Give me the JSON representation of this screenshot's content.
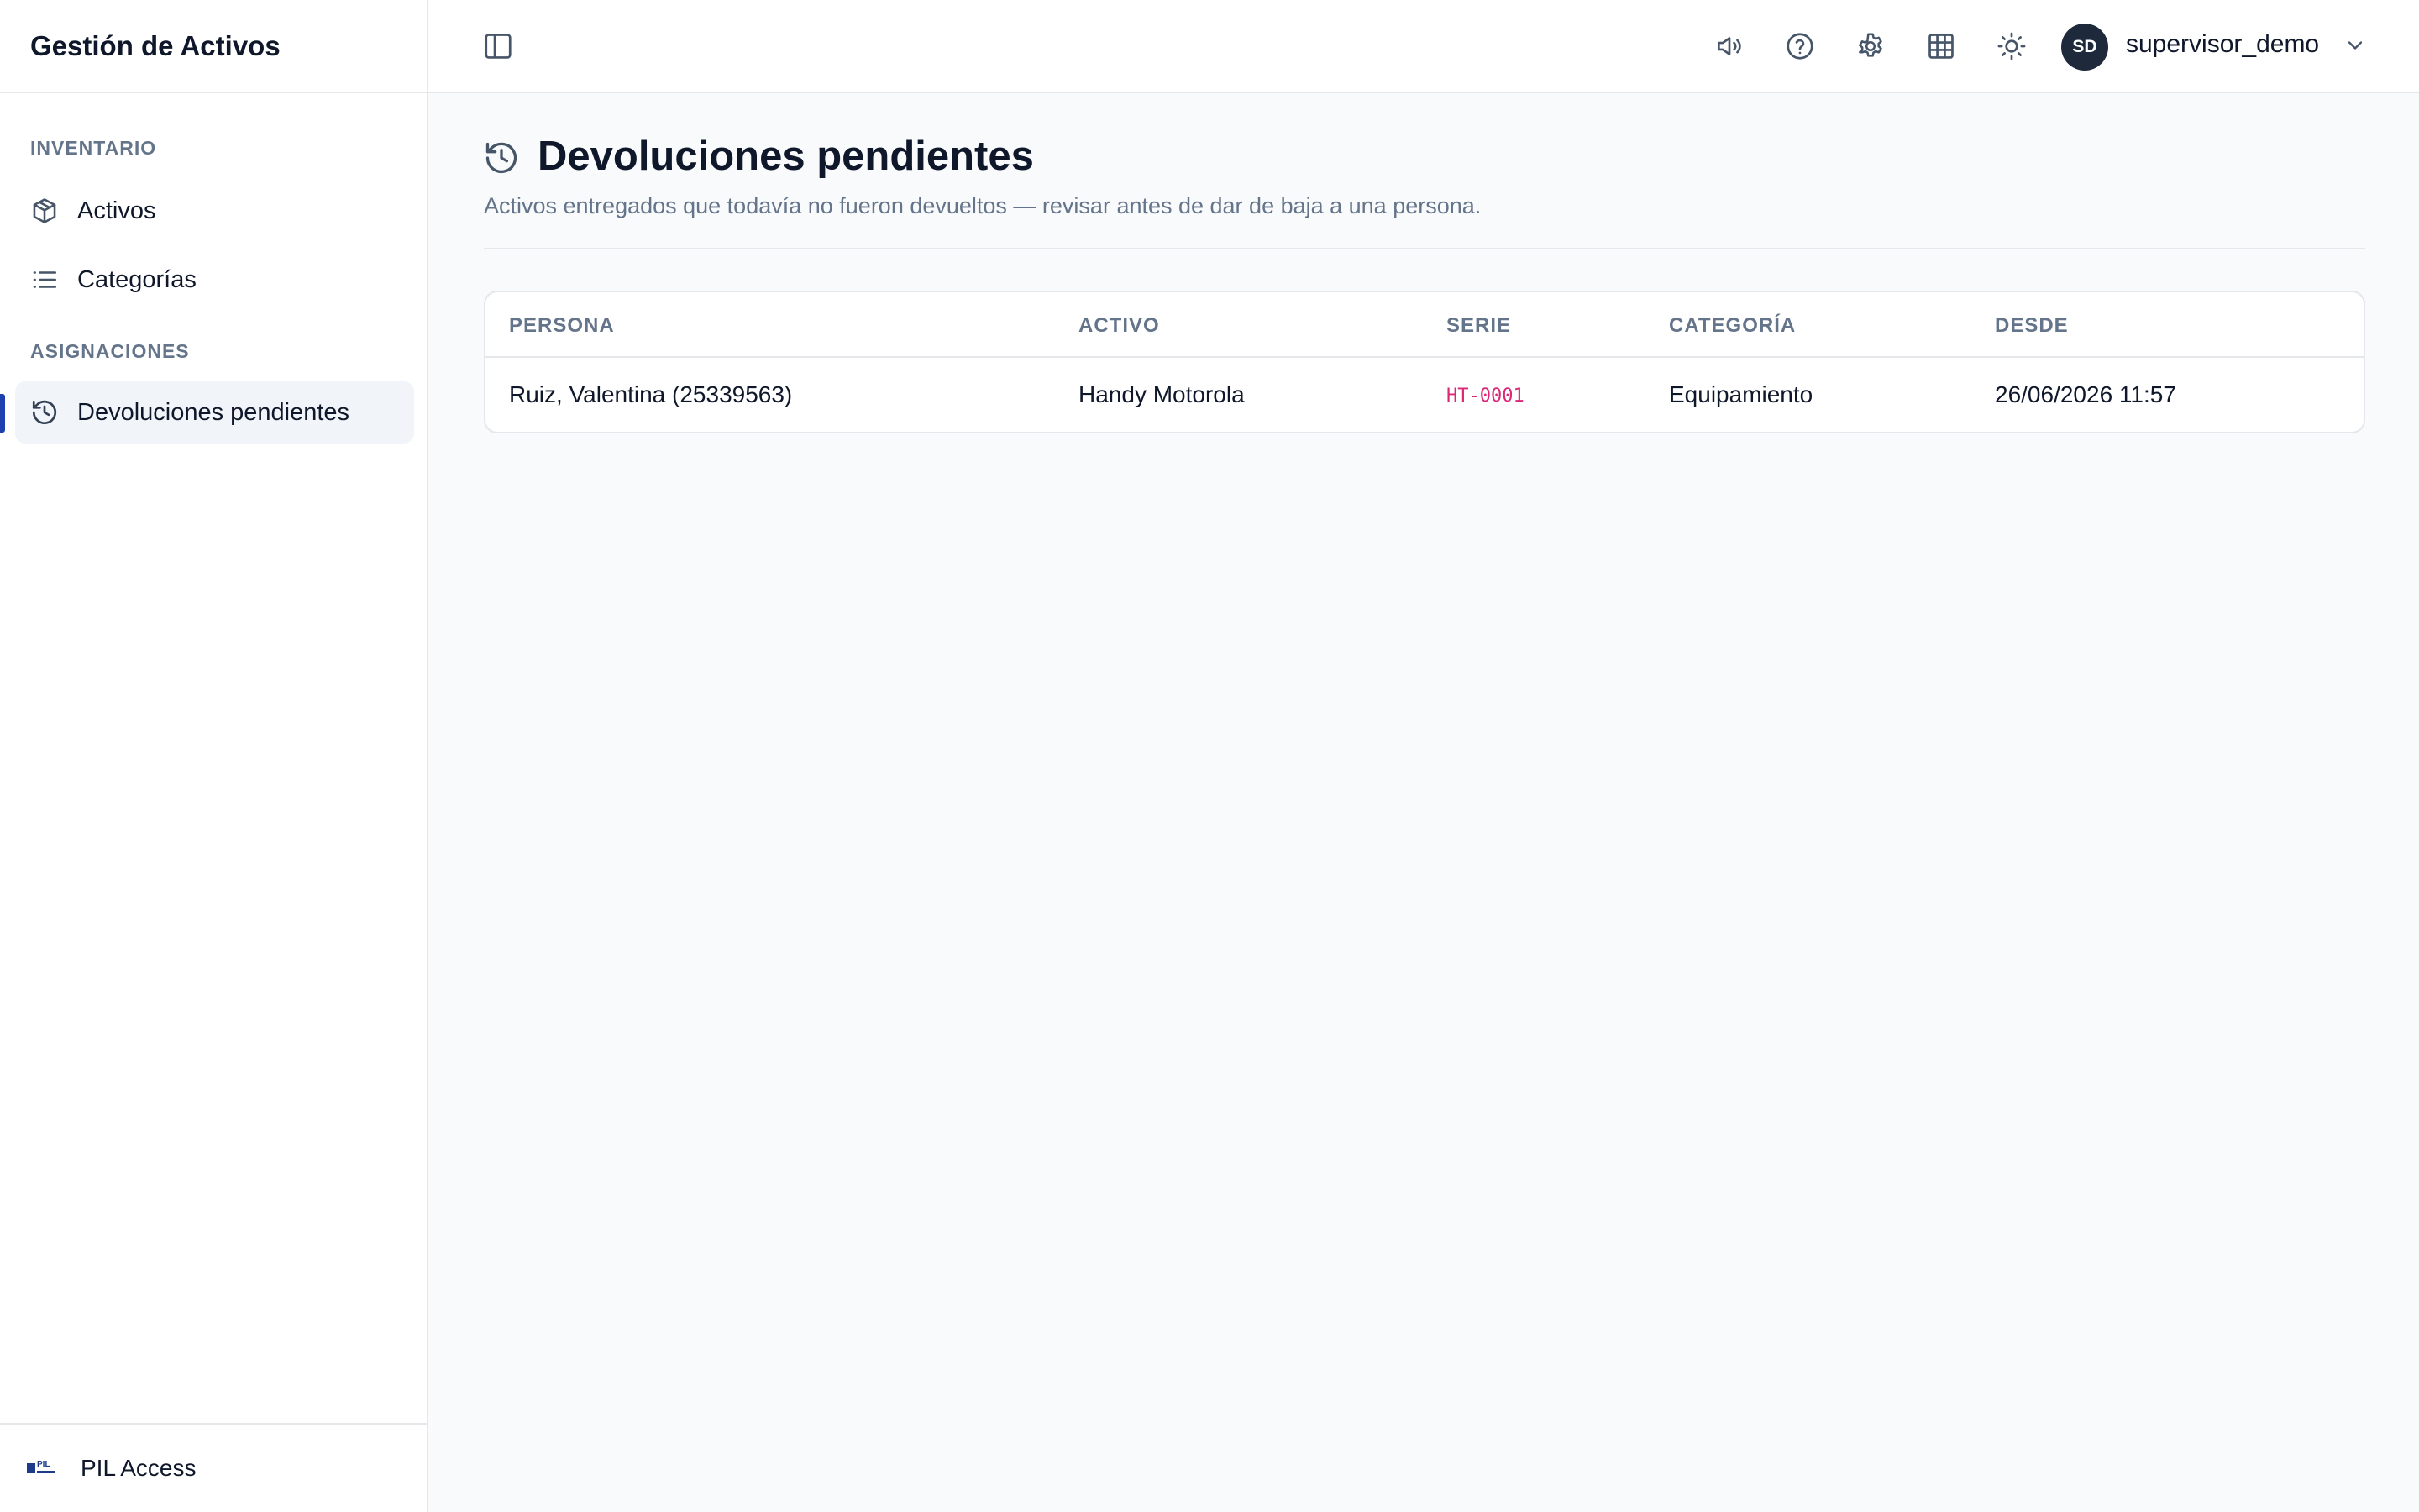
{
  "app": {
    "title": "Gestión de Activos"
  },
  "sidebar": {
    "sections": [
      {
        "label": "INVENTARIO"
      },
      {
        "label": "ASIGNACIONES"
      }
    ],
    "items": [
      {
        "label": "Activos",
        "icon": "package-icon"
      },
      {
        "label": "Categorías",
        "icon": "list-icon"
      },
      {
        "label": "Devoluciones pendientes",
        "icon": "history-icon",
        "active": true
      }
    ],
    "footer": {
      "label": "PIL Access",
      "logo": "pil-logo"
    }
  },
  "topbar": {
    "icons": [
      "sidebar-toggle-icon",
      "megaphone-icon",
      "help-icon",
      "settings-icon",
      "grid-icon",
      "sun-icon",
      "chevron-down-icon"
    ],
    "user": {
      "initials": "SD",
      "name": "supervisor_demo"
    }
  },
  "page": {
    "title": "Devoluciones pendientes",
    "subtitle": "Activos entregados que todavía no fueron devueltos — revisar antes de dar de baja a una persona."
  },
  "table": {
    "headers": [
      "PERSONA",
      "ACTIVO",
      "SERIE",
      "CATEGORÍA",
      "DESDE"
    ],
    "rows": [
      [
        "Ruiz, Valentina (25339563)",
        "Handy Motorola",
        "HT-0001",
        "Equipamiento",
        "26/06/2026 11:57"
      ]
    ]
  },
  "colors": {
    "accent": "#1e40af",
    "serial": "#db2777",
    "muted": "#64748b",
    "text": "#0f172a",
    "avatar_bg": "#1e293b"
  }
}
